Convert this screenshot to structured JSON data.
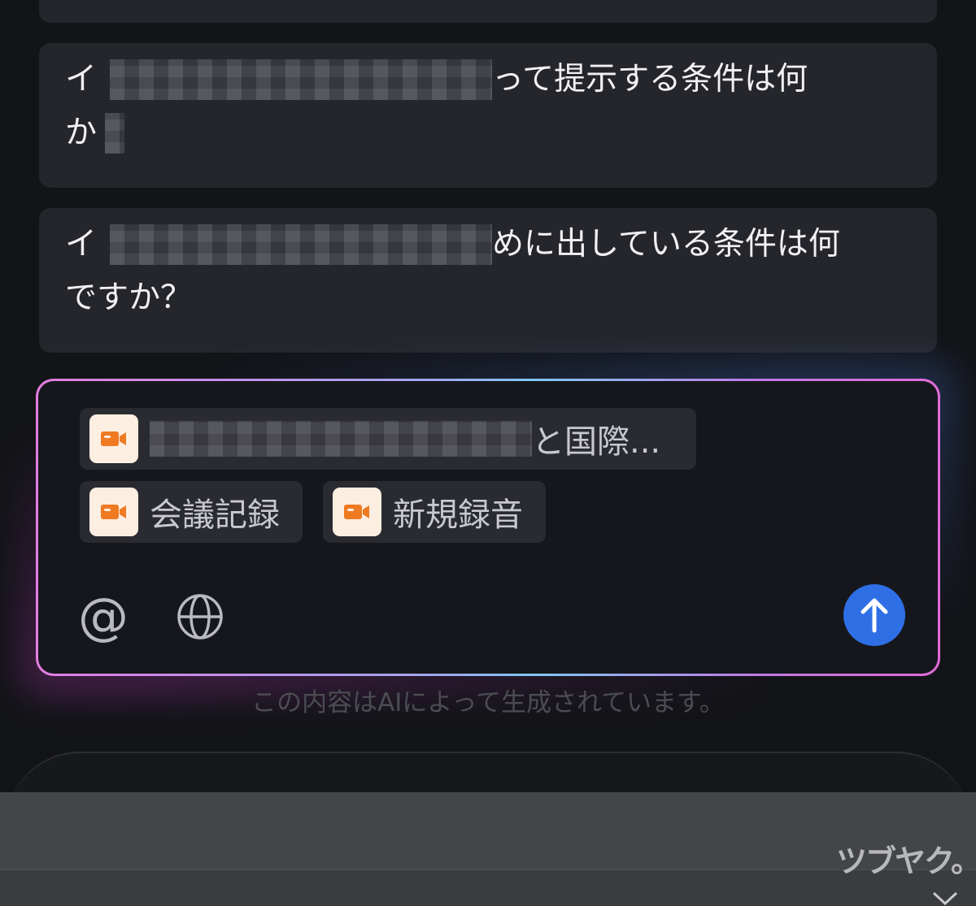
{
  "suggestions": [
    {
      "prefix": "イ",
      "suffix": "って提示する条件は何",
      "line2_prefix": "か"
    },
    {
      "prefix": "イ",
      "suffix": "めに出している条件は何",
      "line2": "ですか？"
    }
  ],
  "attachments": [
    {
      "label": "と国際...",
      "icon": "video-camera-icon"
    },
    {
      "label": "会議記録",
      "icon": "video-camera-icon"
    },
    {
      "label": "新規録音",
      "icon": "video-camera-icon"
    }
  ],
  "toolbar": {
    "mention_glyph": "@",
    "web_search_icon": "globe-icon",
    "send_icon": "arrow-up-icon"
  },
  "disclaimer": "この内容はAIによって生成されています。",
  "watermark": "ツブヤク。",
  "colors": {
    "accent": "#2f6fe6",
    "chip_icon_bg": "#fdeee2",
    "chip_icon_fg": "#ef7a22",
    "border_gradient": [
      "#e27ce0",
      "#7ec8f2",
      "#e16bd8"
    ]
  }
}
